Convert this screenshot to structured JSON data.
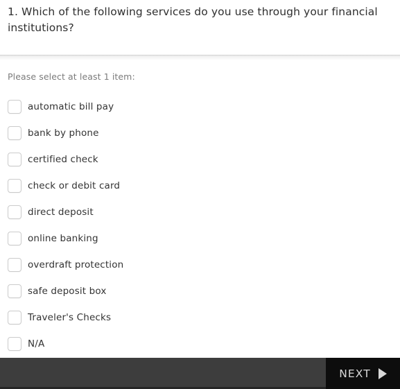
{
  "question": {
    "text": "1. Which of the following services do you use through your financial institutions?",
    "instruction": "Please select at least 1 item:"
  },
  "choices": [
    {
      "label": "automatic bill pay",
      "checked": false
    },
    {
      "label": "bank by phone",
      "checked": false
    },
    {
      "label": "certified check",
      "checked": false
    },
    {
      "label": "check or debit card",
      "checked": false
    },
    {
      "label": "direct deposit",
      "checked": false
    },
    {
      "label": "online banking",
      "checked": false
    },
    {
      "label": "overdraft protection",
      "checked": false
    },
    {
      "label": "safe deposit box",
      "checked": false
    },
    {
      "label": "Traveler's Checks",
      "checked": false
    },
    {
      "label": "N/A",
      "checked": false
    }
  ],
  "nav": {
    "next_label": "NEXT",
    "next_icon": "triangle-right-icon"
  },
  "colors": {
    "nav_bar_bg": "#3d3d3d",
    "next_button_bg": "#0d0d0d",
    "next_text": "#d9d9d9",
    "question_text": "#2f2f2f",
    "instruction_text": "#7b7b7b",
    "label_text": "#333333",
    "checkbox_border": "#cbcbcb",
    "divider": "#d4d4d4",
    "page_bg": "#ffffff"
  }
}
